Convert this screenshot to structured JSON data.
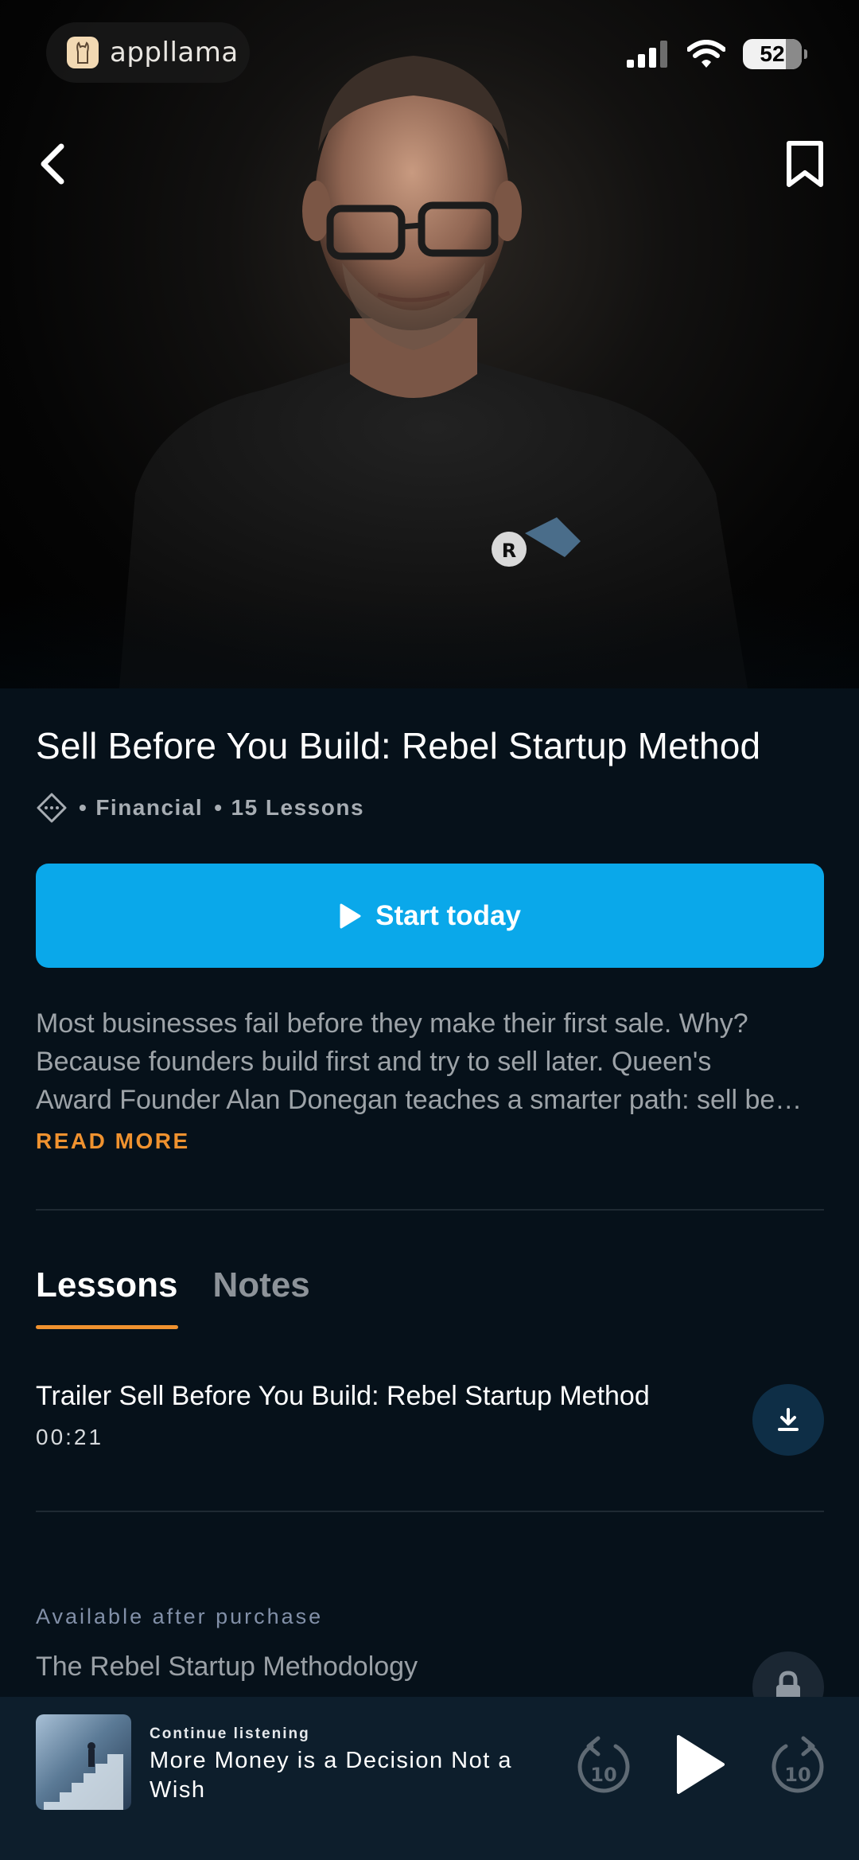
{
  "status_bar": {
    "app_badge": "appllama",
    "battery_level": "52"
  },
  "hero": {
    "image_desc_icon": "portrait-photo"
  },
  "course": {
    "title": "Sell Before You Build: Rebel Startup Method",
    "category": "Financial",
    "lessons_count": "15 Lessons",
    "start_label": "Start today",
    "description_lines": [
      "Most businesses fail before they make their first sale. Why?",
      "Because founders build first and try to sell later. Queen's",
      "Award Founder Alan Donegan teaches a smarter path: sell be…"
    ],
    "read_more": "READ MORE"
  },
  "tabs": [
    {
      "label": "Lessons",
      "active": true
    },
    {
      "label": "Notes",
      "active": false
    }
  ],
  "lessons": {
    "trailer_title": "Trailer Sell Before You Build: Rebel Startup Method",
    "trailer_duration": "00:21",
    "available_label": "Available after purchase",
    "locked_title": "The Rebel Startup Methodology"
  },
  "player": {
    "continue_label": "Continue listening",
    "episode_title": "More Money is a Decision Not a Wish",
    "skip_back_seconds": "10",
    "skip_forward_seconds": "10"
  },
  "colors": {
    "accent": "#0aa8ea",
    "highlight": "#f0922f",
    "background": "#06111a"
  }
}
